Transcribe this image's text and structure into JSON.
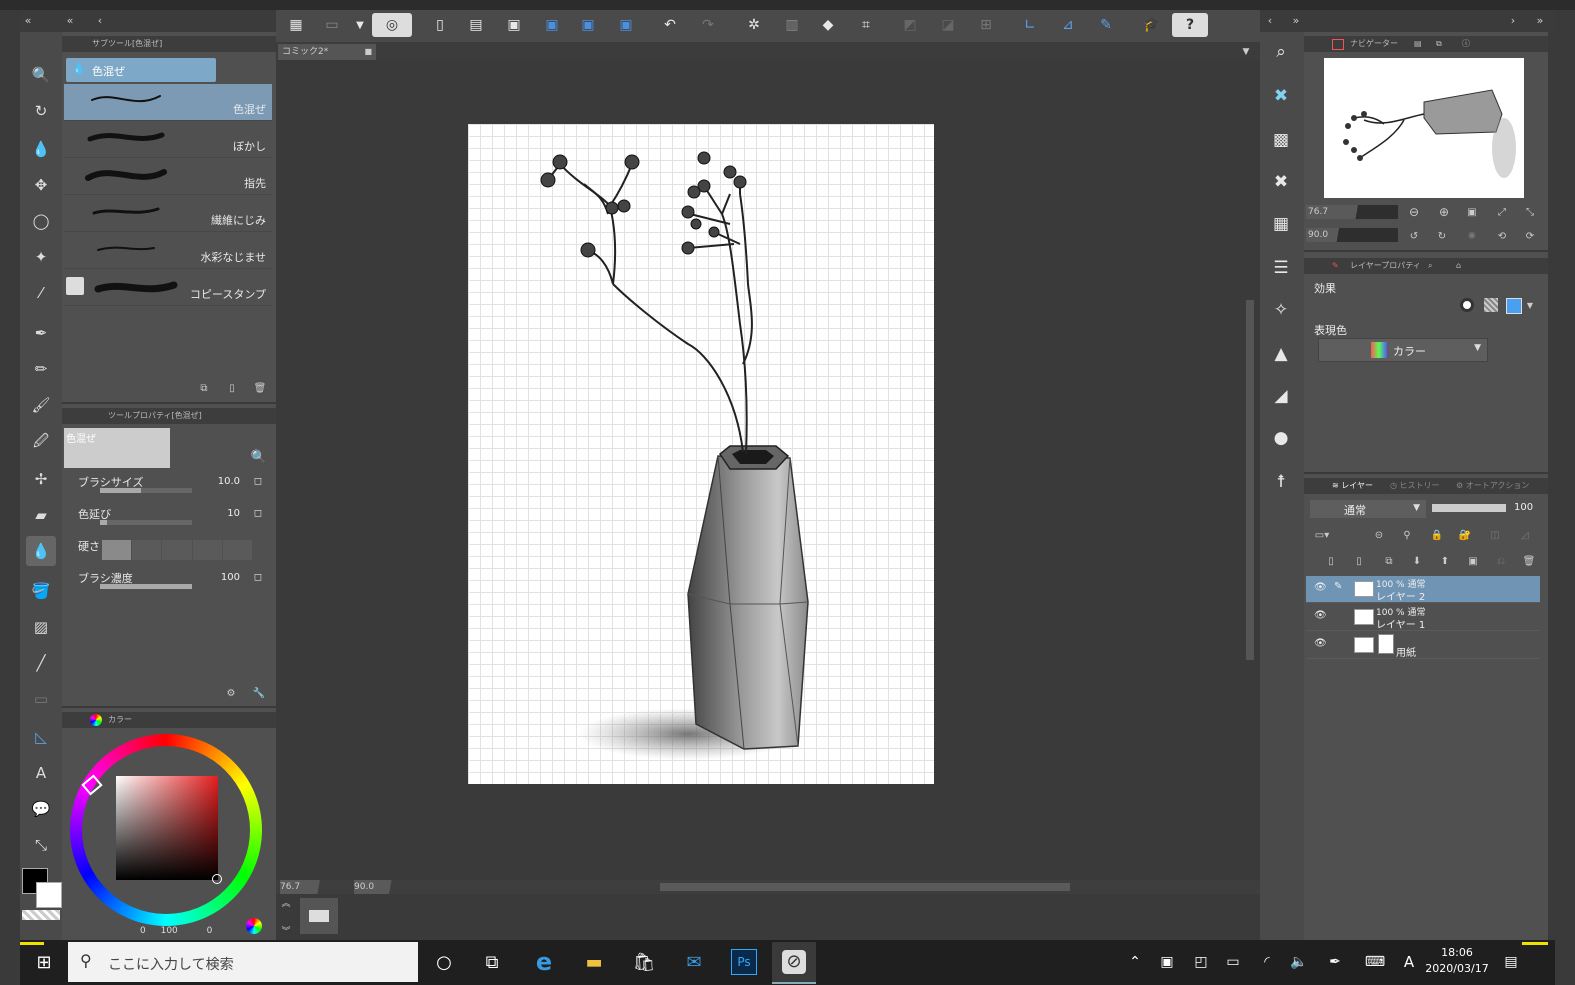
{
  "app": {
    "doc_tab": "コミック2*"
  },
  "sub_tool_panel": {
    "tab": "サブツール[色混ぜ]",
    "group": "色混ぜ",
    "items": [
      {
        "label": "色混ぜ",
        "selected": true
      },
      {
        "label": "ぼかし"
      },
      {
        "label": "指先"
      },
      {
        "label": "繊維にじみ"
      },
      {
        "label": "水彩なじませ"
      },
      {
        "label": "コピースタンプ"
      }
    ]
  },
  "tool_property": {
    "tab": "ツールプロパティ[色混ぜ]",
    "preview_label": "色混ぜ",
    "rows": [
      {
        "name": "ブラシサイズ",
        "value": "10.0",
        "fill": 0.45
      },
      {
        "name": "色延び",
        "value": "10",
        "fill": 0.08
      },
      {
        "name": "硬さ",
        "value": ""
      },
      {
        "name": "ブラシ濃度",
        "value": "100",
        "fill": 1.0
      }
    ]
  },
  "color_panel": {
    "tab": "カラー",
    "readout": [
      "0",
      "100",
      "0"
    ]
  },
  "canvas_status": {
    "zoom": "76.7",
    "angle": "90.0"
  },
  "navigator": {
    "tab": "ナビゲーター",
    "zoom": "76.7",
    "angle": "90.0"
  },
  "layer_property": {
    "tab": "レイヤープロパティ",
    "effect_label": "効果",
    "expression_label": "表現色",
    "expression_value": "カラー"
  },
  "layer_panel": {
    "tabs": [
      "レイヤー",
      "ヒストリー",
      "オートアクション"
    ],
    "blend_mode": "通常",
    "opacity": "100",
    "layers": [
      {
        "mode": "100 % 通常",
        "name": "レイヤー 2",
        "selected": true
      },
      {
        "mode": "100 % 通常",
        "name": "レイヤー 1",
        "selected": false
      },
      {
        "mode": "",
        "name": "用紙",
        "selected": false
      }
    ]
  },
  "taskbar": {
    "search_placeholder": "ここに入力して検索",
    "time": "18:06",
    "date": "2020/03/17",
    "ime": "A"
  }
}
